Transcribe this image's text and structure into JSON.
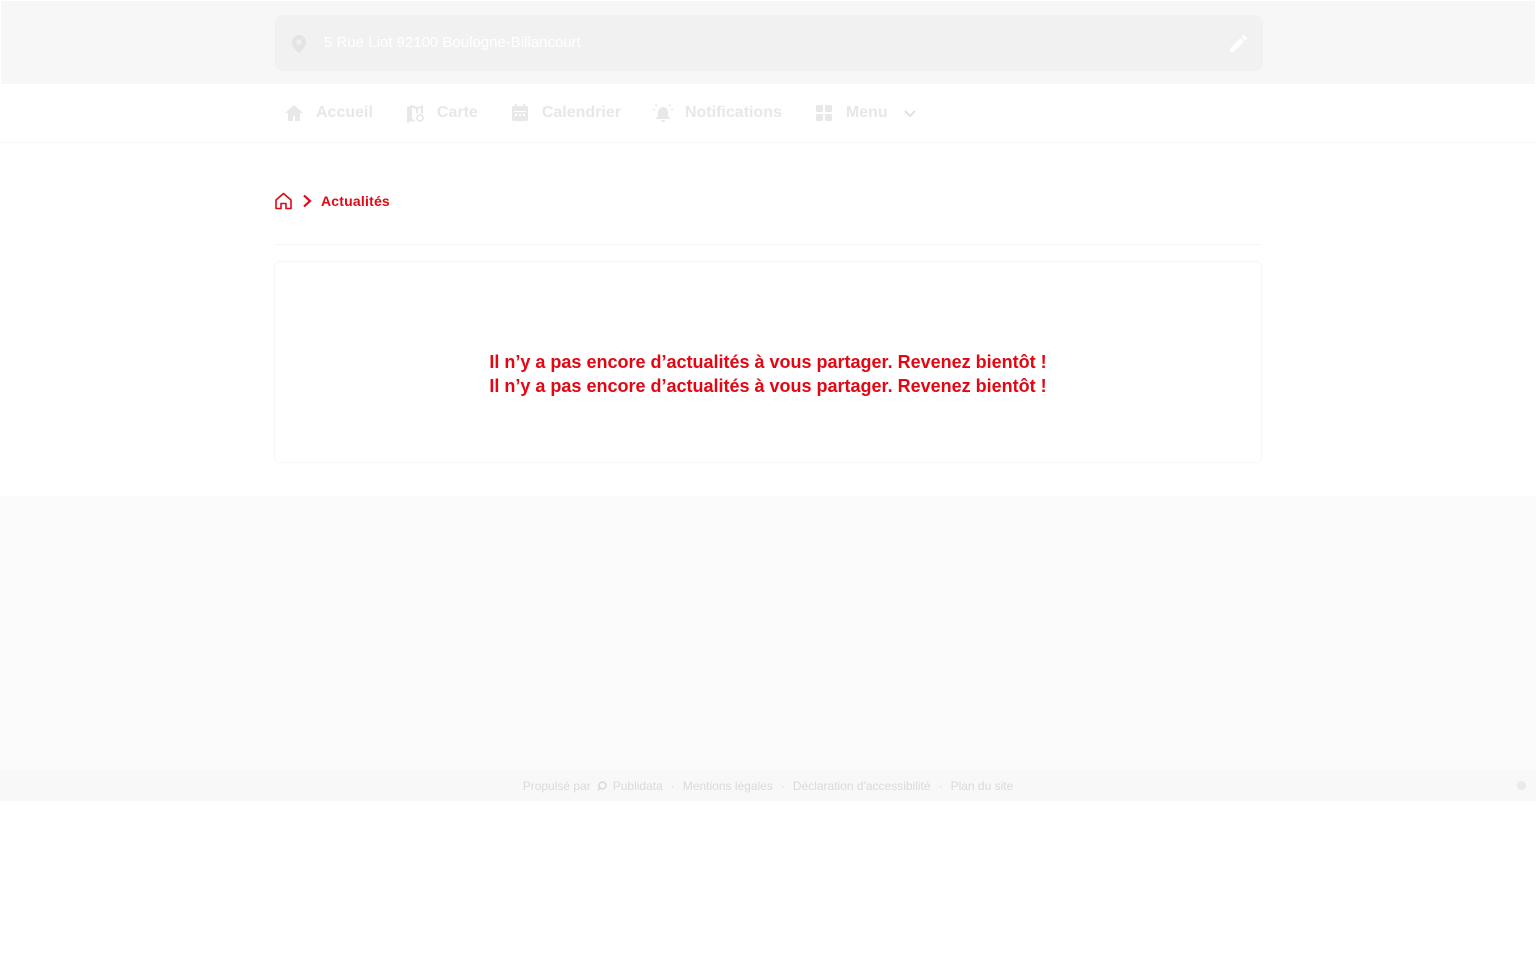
{
  "header": {
    "address": "5 Rue Liot 92100 Boulogne-Billancourt",
    "icons": {
      "location": "map-pin-icon",
      "edit": "pencil-icon"
    }
  },
  "nav": {
    "items": [
      {
        "label": "Accueil",
        "icon": "home-icon"
      },
      {
        "label": "Carte",
        "icon": "map-icon"
      },
      {
        "label": "Calendrier",
        "icon": "calendar-icon"
      },
      {
        "label": "Notifications",
        "icon": "alarm-bell-icon"
      },
      {
        "label": "Menu",
        "icon": "grid-icon",
        "has_dropdown": true
      }
    ]
  },
  "breadcrumb": {
    "home_icon": "home-outline-icon",
    "separator_icon": "chevron-right-icon",
    "current": "Actualités"
  },
  "main": {
    "empty_message": [
      "Il n’y a pas encore d’actualités à vous partager. Revenez bientôt !",
      "Il n’y a pas encore d’actualités à vous partager. Revenez bientôt !"
    ]
  },
  "footer": {
    "powered_by_label": "Propulsé par",
    "powered_by_brand": "Publidata",
    "links": [
      "Mentions légales",
      "Déclaration d'accessibilité",
      "Plan du site"
    ],
    "separator": "·"
  },
  "colors": {
    "accent": "#e30613",
    "nav_text": "#e7e7e7",
    "header_bg": "#f7f7f7",
    "address_box_bg": "#f1f1f1",
    "page_bg": "#fbfbfb"
  }
}
